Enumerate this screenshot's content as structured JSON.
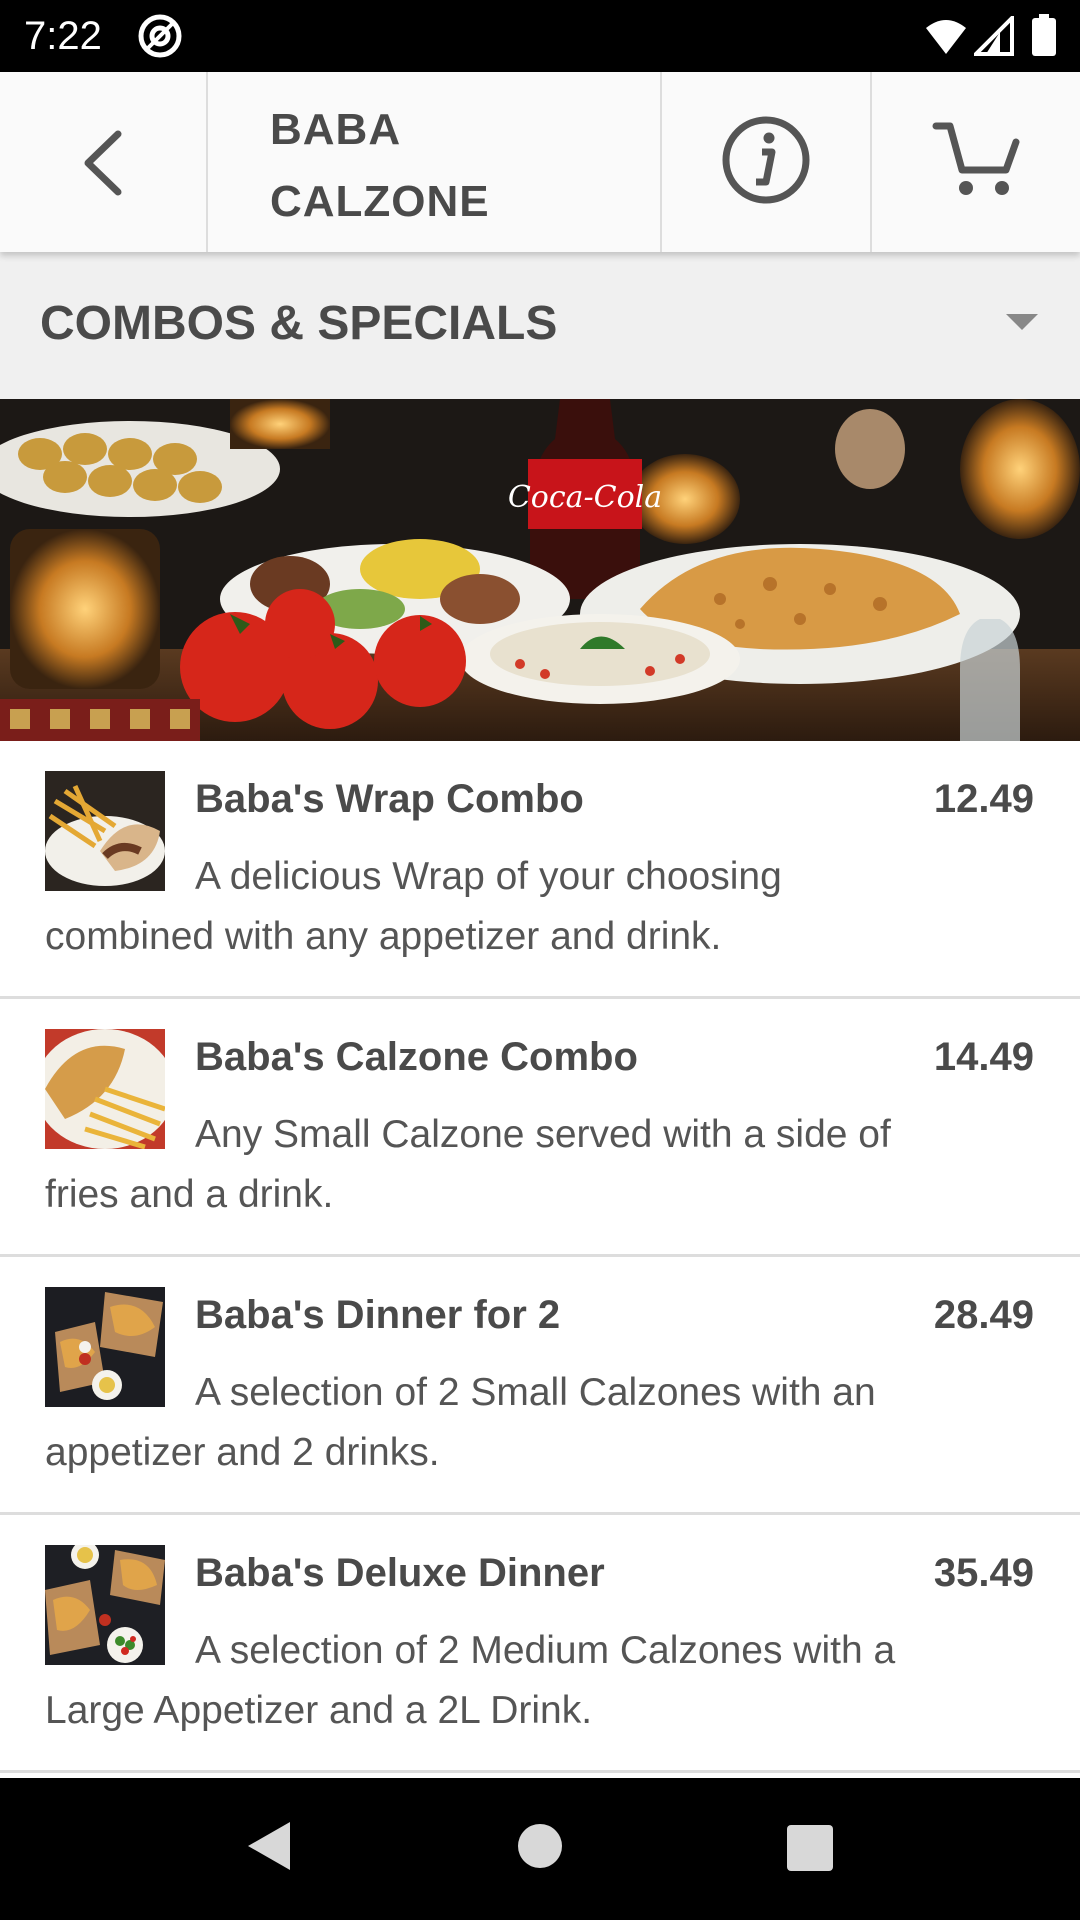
{
  "status_bar": {
    "time": "7:22",
    "icons": [
      "at-sign-icon",
      "wifi-icon",
      "signal-icon",
      "battery-icon"
    ]
  },
  "header": {
    "back_icon": "chevron-left-icon",
    "restaurant_name": "BABA CALZONE",
    "info_icon": "info-icon",
    "cart_icon": "cart-icon"
  },
  "category": {
    "label": "COMBOS & SPECIALS",
    "dropdown_icon": "caret-down-icon"
  },
  "hero": {
    "brand_on_bottle": "Coca-Cola"
  },
  "menu_items": [
    {
      "name": "Baba's Wrap Combo",
      "price": "12.49",
      "description": "A delicious Wrap of your choosing combined with any appetizer and drink."
    },
    {
      "name": "Baba's Calzone Combo",
      "price": "14.49",
      "description": "Any Small Calzone served with a side of fries and a drink."
    },
    {
      "name": "Baba's Dinner for 2",
      "price": "28.49",
      "description": "A selection of 2 Small Calzones with an appetizer and 2 drinks."
    },
    {
      "name": "Baba's Deluxe Dinner",
      "price": "35.49",
      "description": "A selection of 2 Medium Calzones with a Large Appetizer and a 2L Drink."
    }
  ],
  "nav_bar": {
    "icons": [
      "nav-back-icon",
      "nav-home-icon",
      "nav-recents-icon"
    ]
  },
  "colors": {
    "header_bg": "#fafafa",
    "category_bg": "#f0f0f0",
    "text_dark": "#4a4a4a",
    "divider": "#dddddd"
  }
}
